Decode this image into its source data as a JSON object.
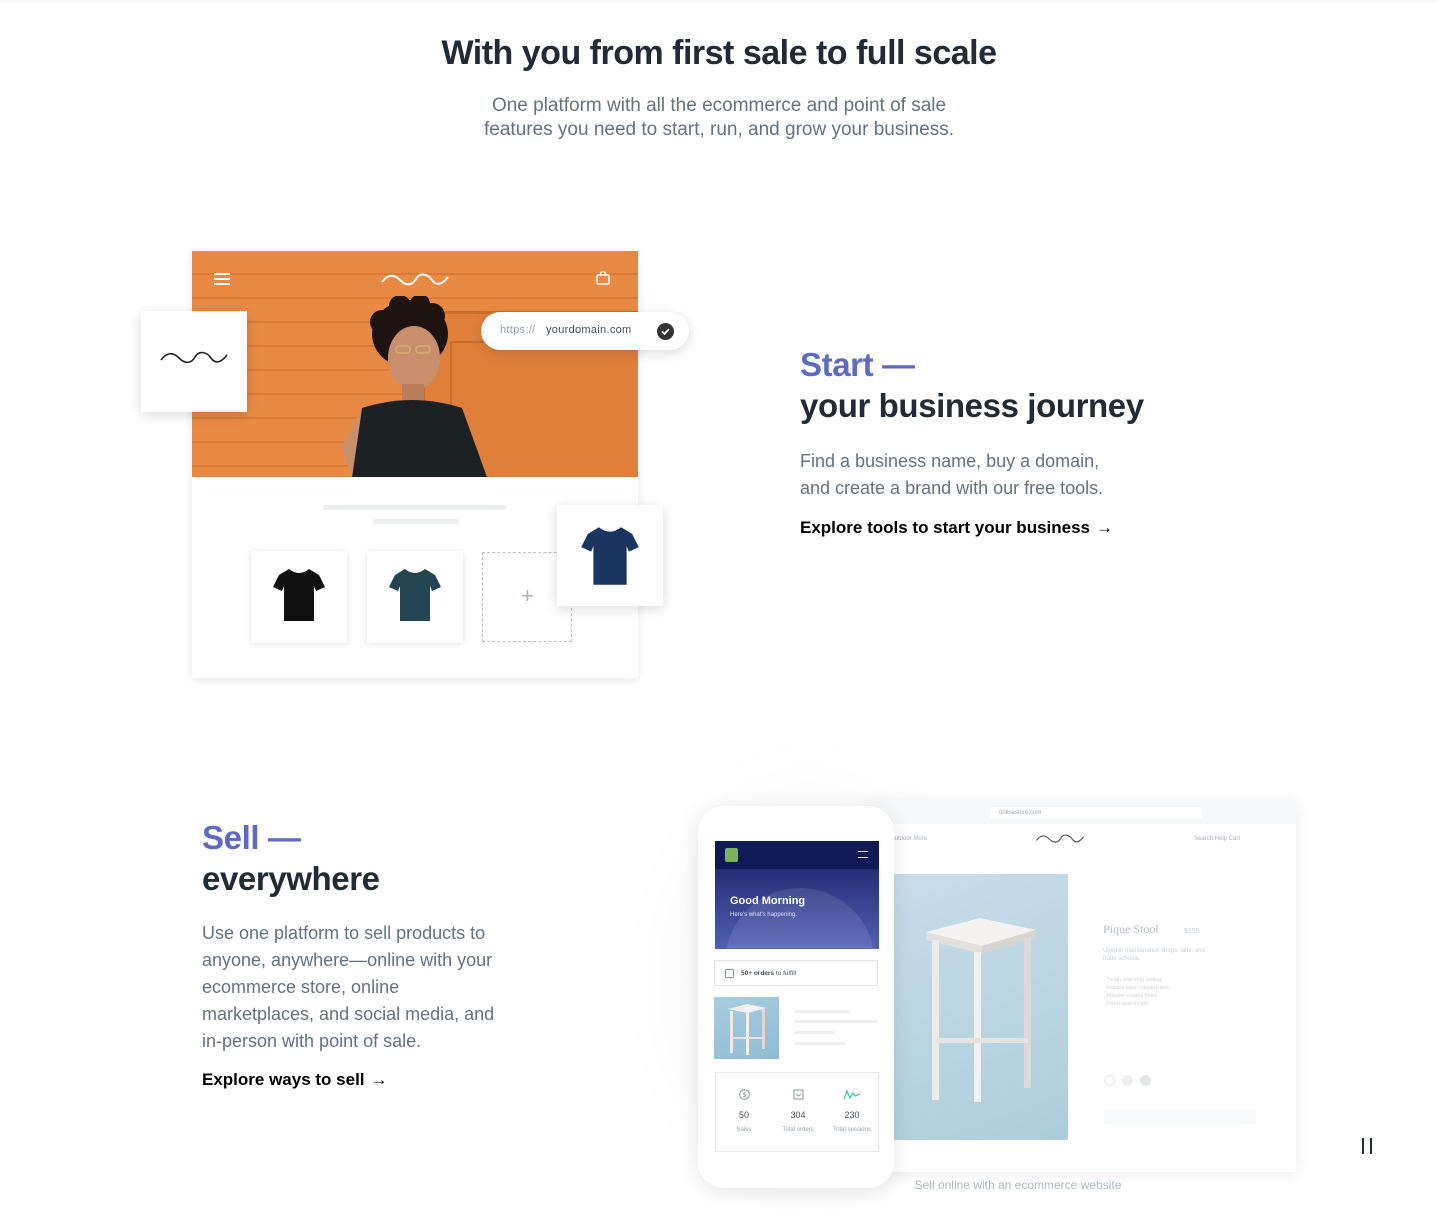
{
  "hero": {
    "title": "With you from first sale to full scale",
    "subtitle_line1": "One platform with all the ecommerce and point of sale",
    "subtitle_line2": "features you need to start, run, and grow your business."
  },
  "start": {
    "kicker": "Start —",
    "heading": "your business journey",
    "body": "Find a business name, buy a domain, and create a brand with our free tools.",
    "cta_label": "Explore tools to start your business",
    "cta_arrow": "→",
    "illustration": {
      "url_protocol": "https://",
      "url_domain": "yourdomain.com",
      "add_tile_symbol": "+",
      "colors": {
        "hero_orange": "#e98a44",
        "shirt_black": "#111111",
        "shirt_teal": "#234452",
        "shirt_navy": "#1b3563"
      }
    }
  },
  "sell": {
    "kicker": "Sell —",
    "heading": "everywhere",
    "body": "Use one platform to sell products to anyone, anywhere—online with your ecommerce store, online marketplaces, and social media, and in-person with point of sale.",
    "cta_label": "Explore ways to sell",
    "cta_arrow": "→",
    "phone": {
      "greeting": "Good Morning",
      "greeting_sub": "Here's what's happening.",
      "orders_bold": "50+ orders",
      "orders_rest": " to fulfill",
      "stats": [
        {
          "icon": "dollar-icon",
          "value": "50",
          "label": "Sales"
        },
        {
          "icon": "inbox-icon",
          "value": "304",
          "label": "Total orders"
        },
        {
          "icon": "sessions-chart-icon",
          "value": "230",
          "label": "Total sessions"
        }
      ]
    },
    "desktop": {
      "address": "onlinestore.com",
      "nav_left": "Outdoor   More",
      "nav_right": "Search   Help   Cart",
      "product_name": "Pique Stool",
      "product_price": "$155",
      "product_desc": "Used in maintenance shops, labs, and trade schools.",
      "product_bullets": [
        "- Tough and long lasting",
        "- Molded steel construction",
        "- Powder-coated finish",
        "- Fixed seat height"
      ]
    },
    "caption": "Sell online with an ecommerce website"
  },
  "controls": {
    "pause_label": "Pause animation"
  },
  "colors": {
    "accent": "#5c6ac4",
    "heading": "#212b36",
    "body": "#637381"
  }
}
